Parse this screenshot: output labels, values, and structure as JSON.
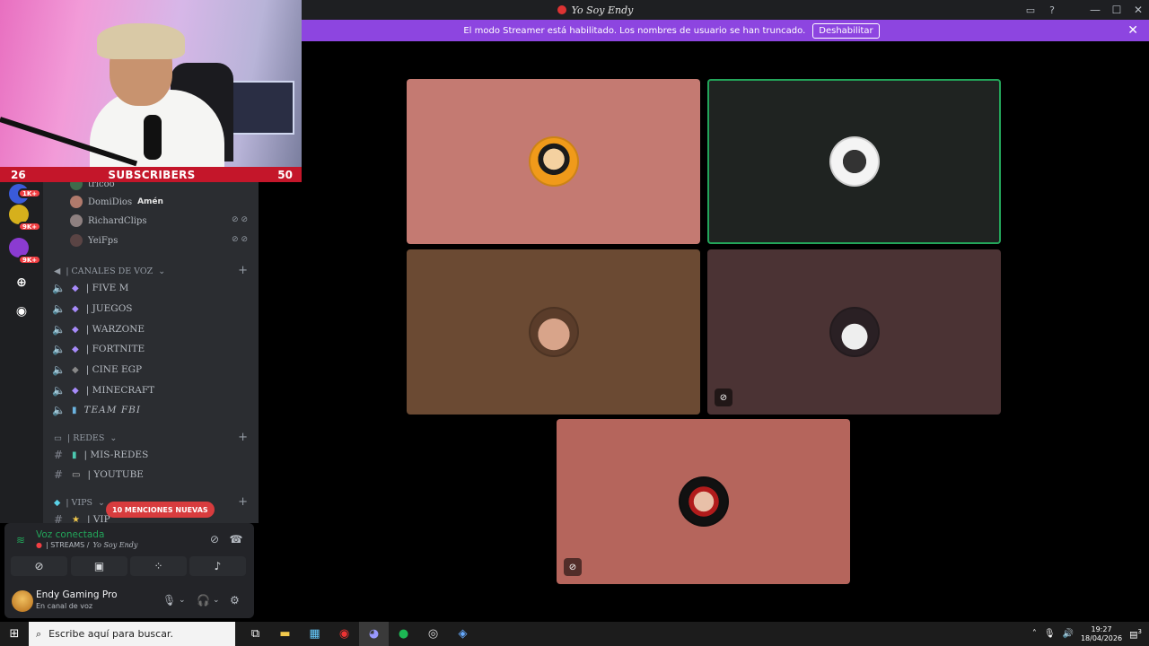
{
  "window": {
    "title": "Yo Soy Endy"
  },
  "banner": {
    "message": "El modo Streamer está habilitado. Los nombres de usuario se han truncado.",
    "button": "Deshabilitar"
  },
  "subscribers": {
    "left": "26",
    "label": "SUBSCRIBERS",
    "right": "50"
  },
  "rail_badges": [
    "1K+",
    "9K+",
    "9K+"
  ],
  "members": [
    {
      "name": "tricoo",
      "tag": ""
    },
    {
      "name": "DomiDios",
      "tag": "Amén"
    },
    {
      "name": "RichardClips",
      "tag": ""
    },
    {
      "name": "YeiFps",
      "tag": ""
    }
  ],
  "voice_category": {
    "label": "| CANALES DE VOZ"
  },
  "voice_channels": [
    "| FIVE M",
    "| JUEGOS",
    "| WARZONE",
    "| FORTNITE",
    "| CINE EGP",
    "| MINECRAFT",
    "TEAM FBI"
  ],
  "redes_category": {
    "label": "| REDES"
  },
  "redes_channels": [
    "| MIS-REDES",
    "| YOUTUBE"
  ],
  "vips_category": {
    "label": "| VIPS"
  },
  "vips_channels": [
    "| VIP"
  ],
  "mentions": {
    "label": "10 MENCIONES NUEVAS"
  },
  "voice_panel": {
    "status": "Voz conectada",
    "channel_prefix": "| STREAMS /",
    "server": "Yo Soy Endy"
  },
  "user_panel": {
    "name": "Endy Gaming Pro",
    "status": "En canal de voz"
  },
  "tiles": [
    {
      "bg": "#c47a72",
      "avatar": "endy-avatar",
      "speaking": false,
      "muted": false
    },
    {
      "bg": "#1f2321",
      "avatar": "crossed-swords-avatar",
      "speaking": true,
      "muted": false
    },
    {
      "bg": "#6b4a33",
      "avatar": "man-avatar",
      "speaking": false,
      "muted": false
    },
    {
      "bg": "#4b3334",
      "avatar": "dark-avatar",
      "speaking": false,
      "muted": true
    },
    {
      "bg": "#b5655c",
      "avatar": "yei-avatar",
      "speaking": false,
      "muted": true
    }
  ],
  "taskbar": {
    "search_placeholder": "Escribe aquí para buscar.",
    "time": "19:27",
    "date": "18/04/2026",
    "notifications": "3"
  },
  "colors": {
    "accent": "#8d45e0",
    "connected": "#23a55a",
    "danger": "#d83c3e"
  }
}
